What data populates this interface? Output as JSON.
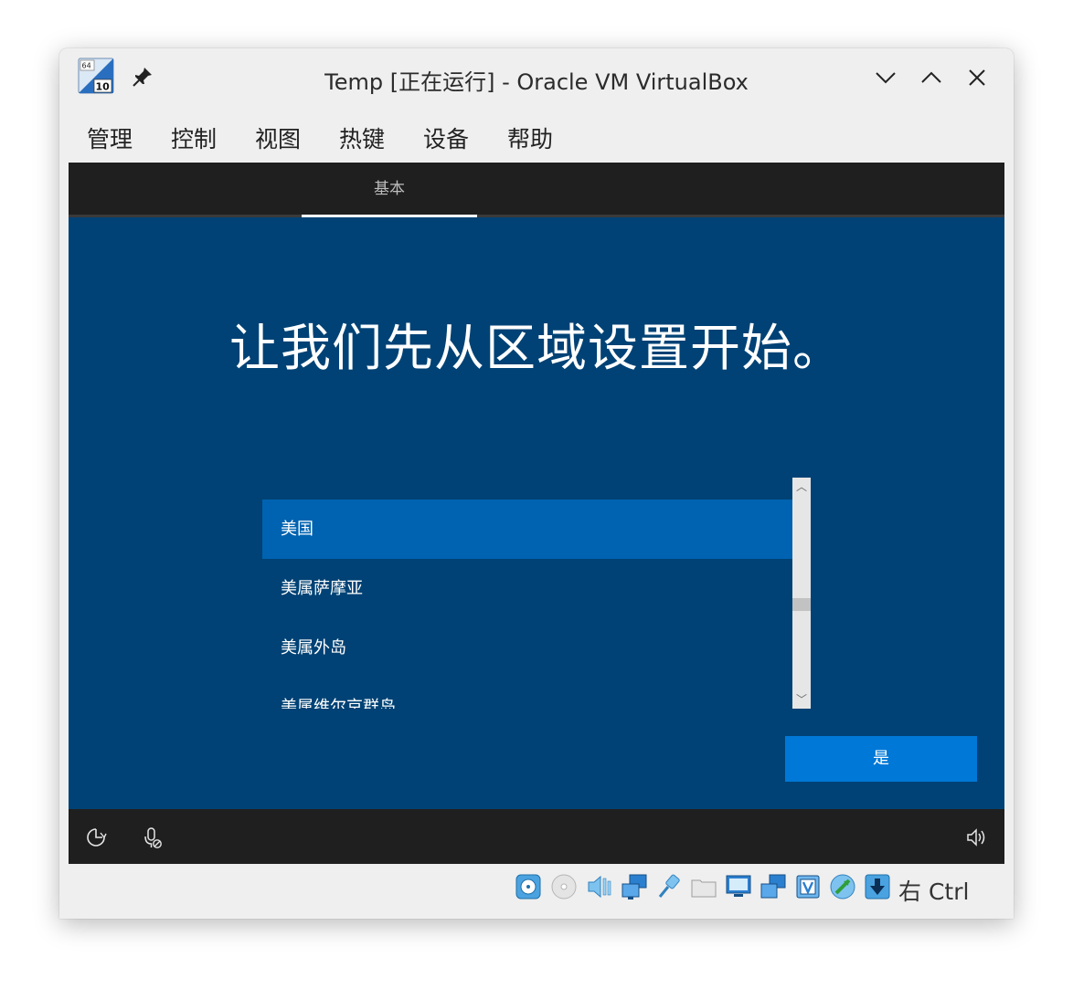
{
  "window": {
    "title": "Temp [正在运行] - Oracle VM VirtualBox",
    "app_icon_badge_top": "64",
    "app_icon_badge_bottom": "10"
  },
  "menu": {
    "items": [
      "管理",
      "控制",
      "视图",
      "热键",
      "设备",
      "帮助"
    ]
  },
  "oobe": {
    "tab_label": "基本",
    "heading": "让我们先从区域设置开始。",
    "list": {
      "items": [
        "美国",
        "美属萨摩亚",
        "美属外岛",
        "美属维尔京群岛"
      ],
      "selected": "美国"
    },
    "yes_button": "是",
    "bottom_icons": [
      "ease-of-access-icon",
      "microphone-off-icon",
      "volume-icon"
    ],
    "colors": {
      "background": "#004275",
      "selected_row": "#0063b1",
      "primary_button": "#0078d7",
      "top_bar": "#1f1f1f"
    }
  },
  "statusbar": {
    "icons": [
      "hard-disk-icon",
      "optical-drive-icon",
      "audio-icon",
      "network-icon",
      "usb-icon",
      "shared-folders-icon",
      "display-icon",
      "recording-icon",
      "cpu-icon",
      "mouse-integration-icon",
      "keyboard-capture-icon"
    ],
    "host_key": "右 Ctrl"
  }
}
